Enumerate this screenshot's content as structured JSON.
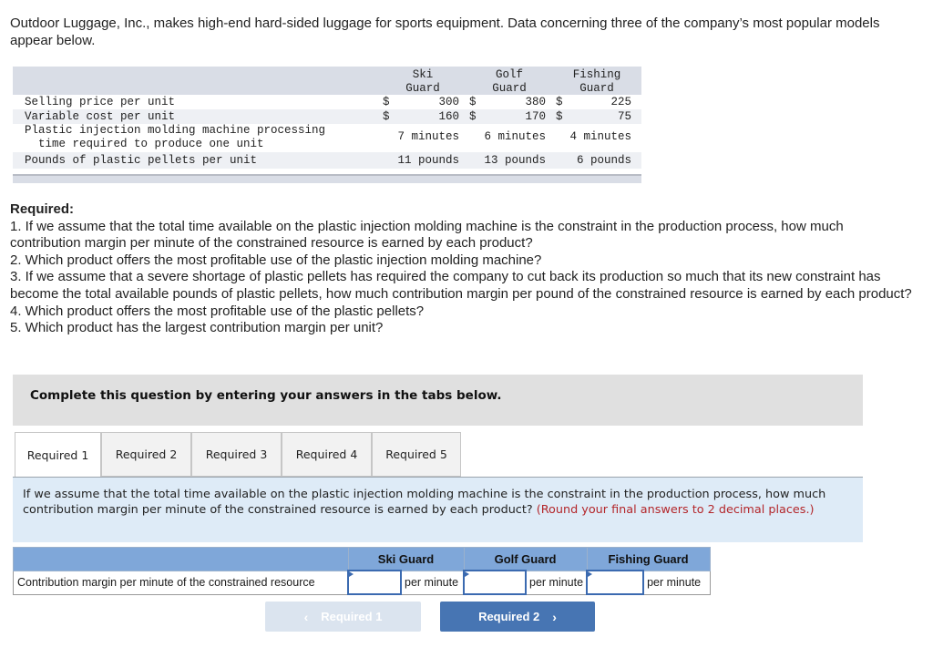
{
  "intro": "Outdoor Luggage, Inc., makes high-end hard-sided luggage for sports equipment. Data concerning three of the company’s most popular models appear below.",
  "data_table": {
    "columns": [
      {
        "line1": "Ski",
        "line2": "Guard"
      },
      {
        "line1": "Golf",
        "line2": "Guard"
      },
      {
        "line1": "Fishing",
        "line2": "Guard"
      }
    ],
    "rows": [
      {
        "label": "Selling price per unit",
        "currency": "$",
        "values": [
          "300",
          "380",
          "225"
        ]
      },
      {
        "label": "Variable cost per unit",
        "currency": "$",
        "values": [
          "160",
          "170",
          "75"
        ]
      },
      {
        "label_line1": "Plastic injection molding machine processing",
        "label_line2": "  time required to produce one unit",
        "values": [
          "7 minutes",
          "6 minutes",
          "4 minutes"
        ]
      },
      {
        "label": "Pounds of plastic pellets per unit",
        "values": [
          "11 pounds",
          "13 pounds",
          "6 pounds"
        ]
      }
    ]
  },
  "required": {
    "title": "Required:",
    "items": [
      "1. If we assume that the total time available on the plastic injection molding machine is the constraint in the production process, how much contribution margin per minute of the constrained resource is earned by each product?",
      "2. Which product offers the most profitable use of the plastic injection molding machine?",
      "3. If we assume that a severe shortage of plastic pellets has required the company to cut back its production so much that its new constraint has become the total available pounds of plastic pellets, how much contribution margin per pound of the constrained resource is earned by each product?",
      "4. Which product offers the most profitable use of the plastic pellets?",
      "5. Which product has the largest contribution margin per unit?"
    ]
  },
  "instructions": "Complete this question by entering your answers in the tabs below.",
  "tabs": [
    {
      "label": "Required 1",
      "active": true
    },
    {
      "label": "Required 2",
      "active": false
    },
    {
      "label": "Required 3",
      "active": false
    },
    {
      "label": "Required 4",
      "active": false
    },
    {
      "label": "Required 5",
      "active": false
    }
  ],
  "question": {
    "text": "If we assume that the total time available on the plastic injection molding machine is the constraint in the production process, how much contribution margin per minute of the constrained resource is earned by each product?",
    "note": "(Round your final answers to 2 decimal places.)"
  },
  "answer_table": {
    "headers": [
      "Ski Guard",
      "Golf Guard",
      "Fishing Guard"
    ],
    "row_label": "Contribution margin per minute of the constrained resource",
    "unit": "per minute",
    "values": [
      "",
      "",
      ""
    ]
  },
  "nav": {
    "prev_label": "Required 1",
    "next_label": "Required 2",
    "prev_icon": "‹",
    "next_icon": "›"
  },
  "colors": {
    "header_blue": "#7fa7d9",
    "question_bg": "#deebf7",
    "note_red": "#b3262a",
    "next_button": "#4775b3",
    "prev_button_disabled": "#dbe4ef"
  }
}
